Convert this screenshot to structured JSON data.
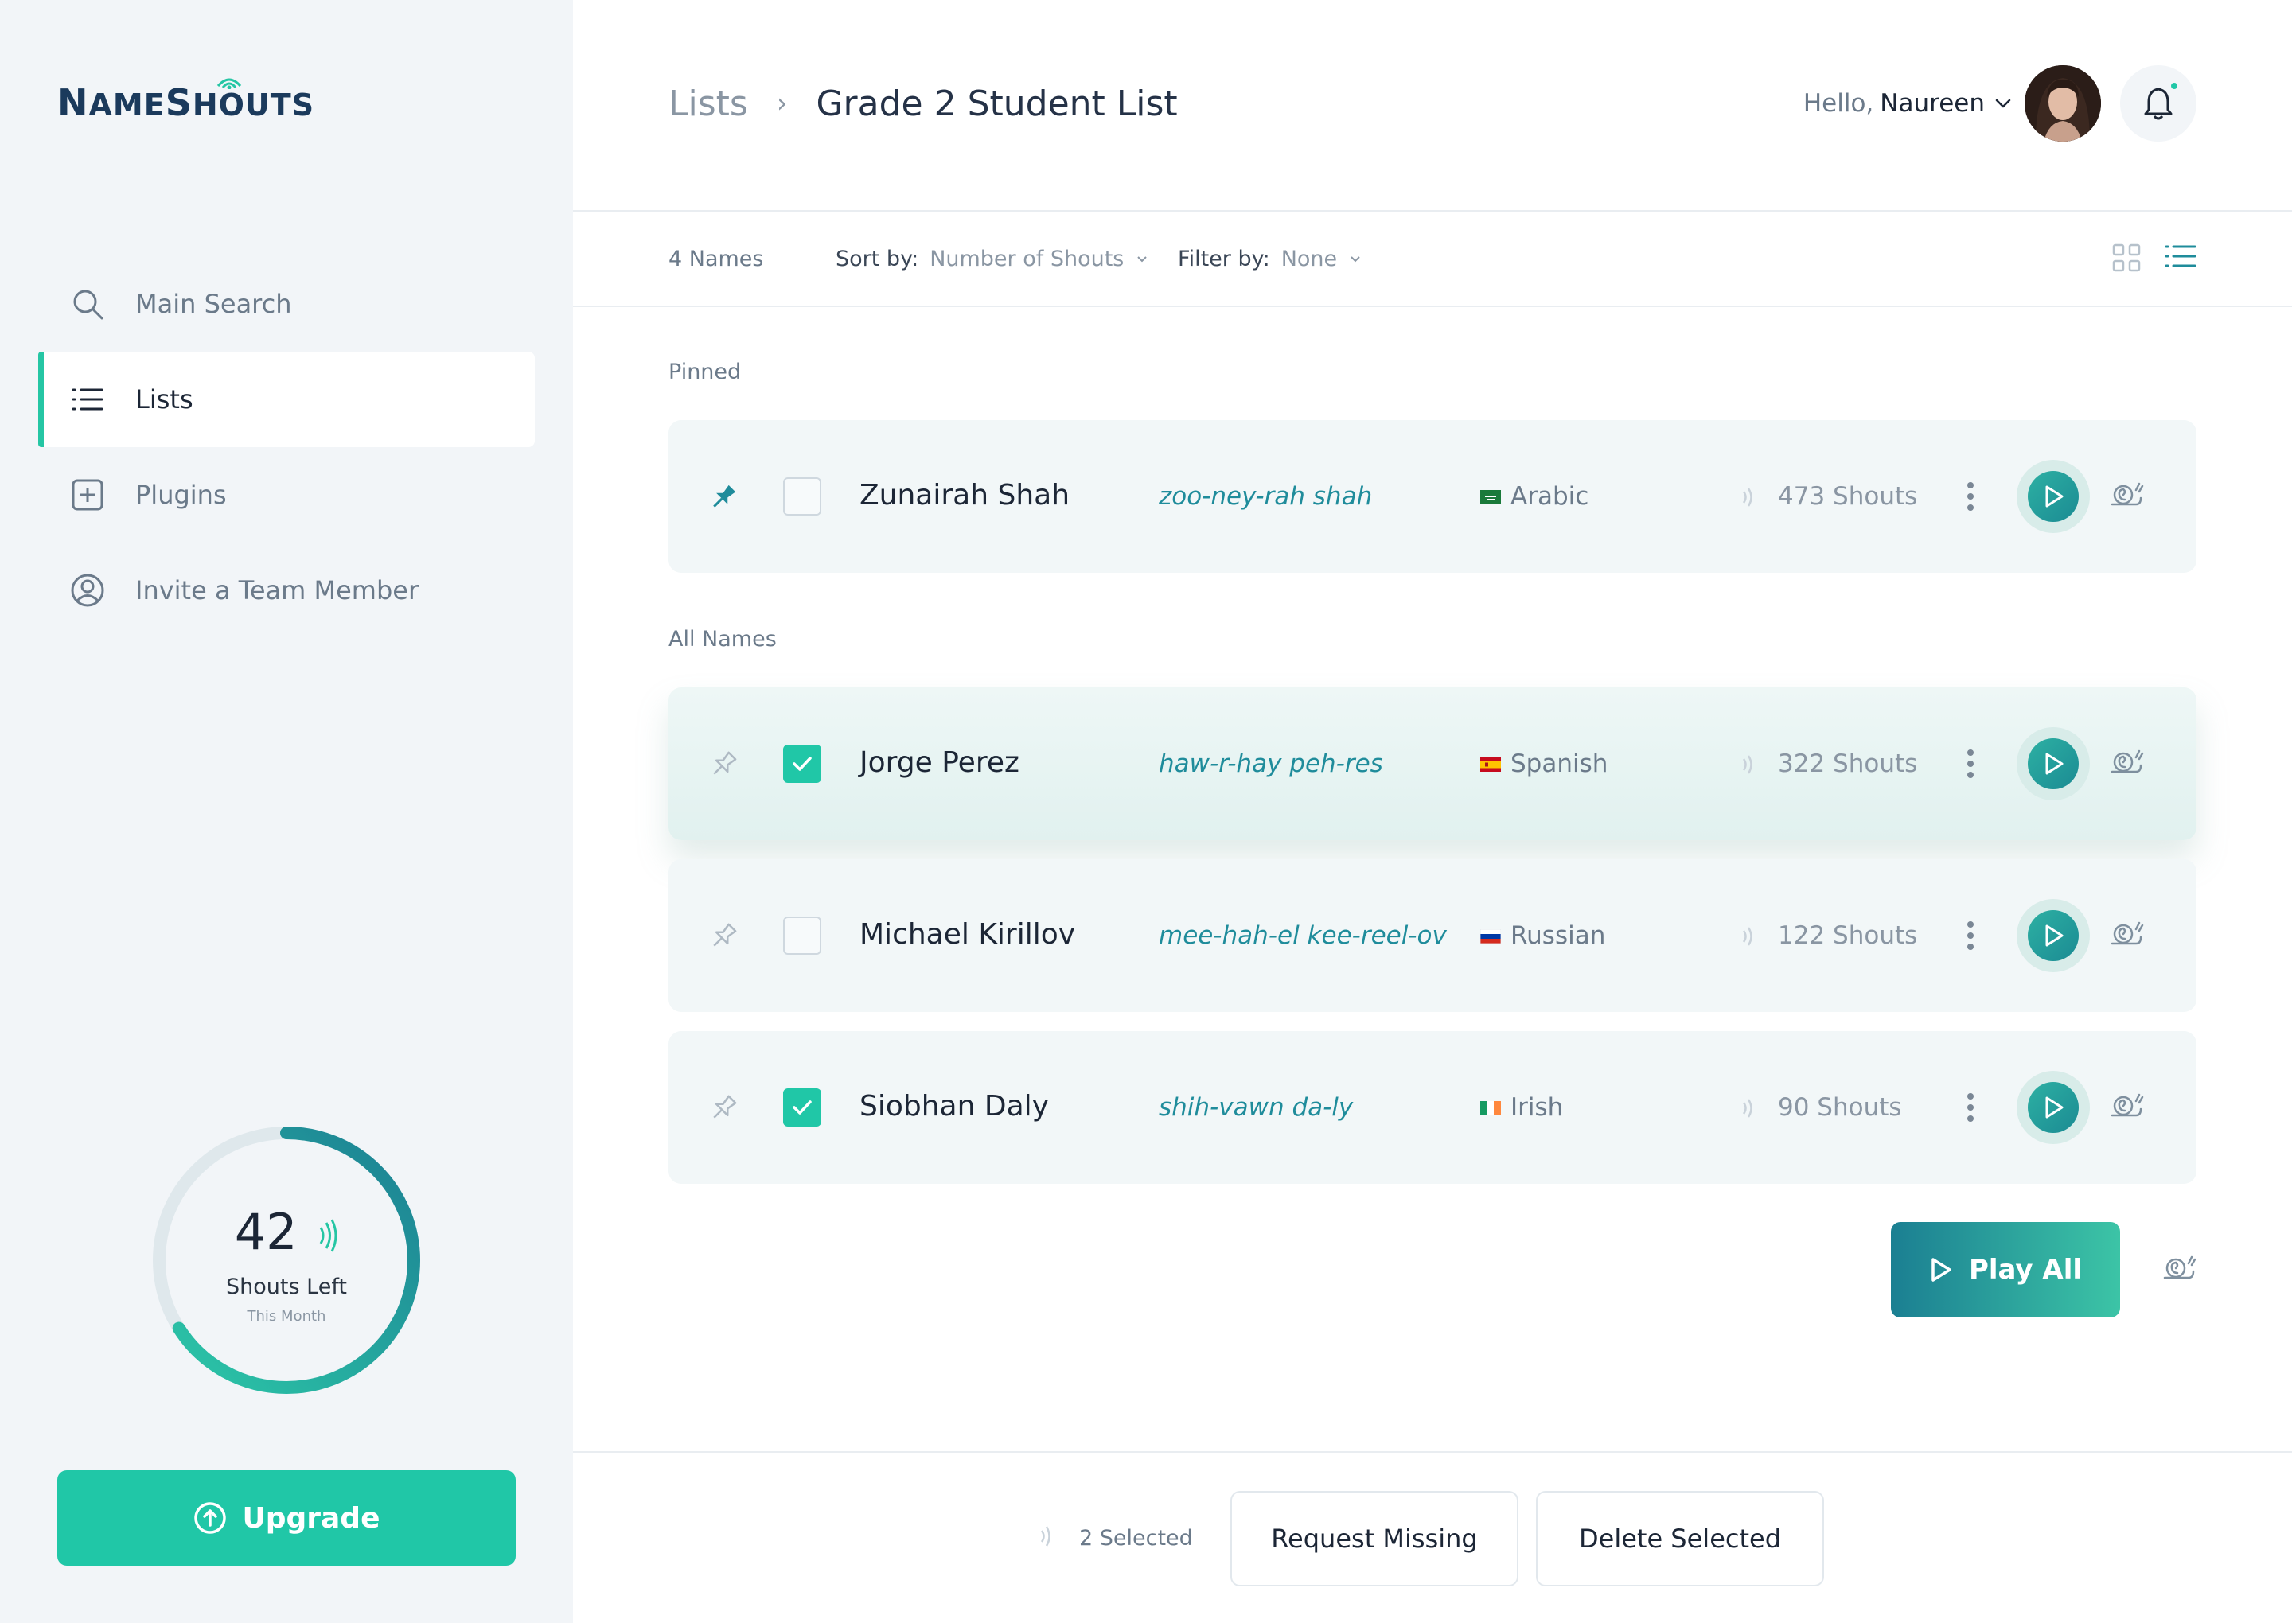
{
  "app": {
    "logo_text": "NameShouts"
  },
  "colors": {
    "accent": "#20c7a7",
    "brand_dark": "#1b3a5c",
    "phonetic": "#1f8c9b"
  },
  "sidebar": {
    "items": [
      {
        "label": "Main Search",
        "icon": "search-icon",
        "active": false
      },
      {
        "label": "Lists",
        "icon": "list-icon",
        "active": true
      },
      {
        "label": "Plugins",
        "icon": "plus-square-icon",
        "active": false
      },
      {
        "label": "Invite a Team Member",
        "icon": "user-circle-icon",
        "active": false
      }
    ],
    "usage": {
      "count": "42",
      "label": "Shouts Left",
      "sublabel": "This Month",
      "progress_fraction": 0.66
    },
    "upgrade_label": "Upgrade"
  },
  "header": {
    "breadcrumb": {
      "parent": "Lists",
      "separator": "›",
      "current": "Grade 2 Student List"
    },
    "greeting": "Hello,",
    "user_name": "Naureen"
  },
  "toolbar": {
    "count": "4 Names",
    "sort_key": "Sort by:",
    "sort_value": "Number of Shouts",
    "filter_key": "Filter by:",
    "filter_value": "None"
  },
  "sections": {
    "pinned": "Pinned",
    "all": "All Names"
  },
  "rows": [
    {
      "name": "Zunairah Shah",
      "phonetic": "zoo-ney-rah shah",
      "language": "Arabic",
      "shouts": "473 Shouts",
      "pinned": true,
      "checked": false,
      "flag": "saudi-flag"
    },
    {
      "name": "Jorge Perez",
      "phonetic": "haw-r-hay peh-res",
      "language": "Spanish",
      "shouts": "322 Shouts",
      "pinned": false,
      "checked": true,
      "flag": "spain-flag"
    },
    {
      "name": "Michael Kirillov",
      "phonetic": "mee-hah-el kee-reel-ov",
      "language": "Russian",
      "shouts": "122 Shouts",
      "pinned": false,
      "checked": false,
      "flag": "russia-flag"
    },
    {
      "name": "Siobhan Daly",
      "phonetic": "shih-vawn da-ly",
      "language": "Irish",
      "shouts": "90 Shouts",
      "pinned": false,
      "checked": true,
      "flag": "ireland-flag"
    }
  ],
  "play_all_label": "Play All",
  "footer": {
    "selected": "2 Selected",
    "request_missing": "Request Missing",
    "delete_selected": "Delete Selected"
  }
}
